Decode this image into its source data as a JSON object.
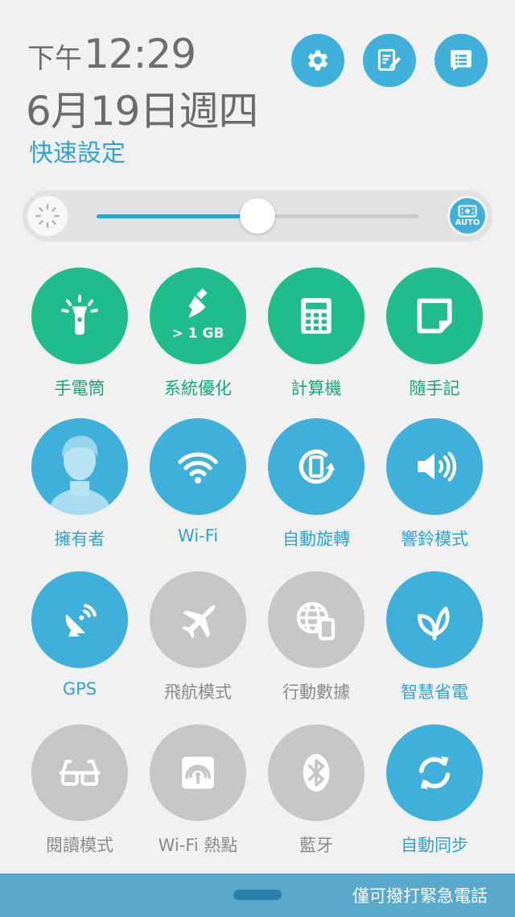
{
  "header": {
    "ampm": "下午",
    "time": "12:29",
    "date": "6月19日週四",
    "section_title": "快速設定",
    "buttons": [
      {
        "name": "settings",
        "icon": "gear-icon"
      },
      {
        "name": "edit",
        "icon": "edit-note-icon"
      },
      {
        "name": "notifications",
        "icon": "list-bubble-icon"
      }
    ]
  },
  "brightness": {
    "level_percent": 50,
    "auto_label": "AUTO"
  },
  "tiles": [
    {
      "label": "手電筒",
      "icon": "flashlight-icon",
      "state": "green"
    },
    {
      "label": "系統優化",
      "icon": "broom-icon",
      "state": "green",
      "sublabel": "> 1 GB"
    },
    {
      "label": "計算機",
      "icon": "calculator-icon",
      "state": "green"
    },
    {
      "label": "隨手記",
      "icon": "note-icon",
      "state": "green"
    },
    {
      "label": "擁有者",
      "icon": "avatar-icon",
      "state": "blue"
    },
    {
      "label": "Wi-Fi",
      "icon": "wifi-icon",
      "state": "blue"
    },
    {
      "label": "自動旋轉",
      "icon": "auto-rotate-icon",
      "state": "blue"
    },
    {
      "label": "響鈴模式",
      "icon": "speaker-icon",
      "state": "blue"
    },
    {
      "label": "GPS",
      "icon": "gps-dish-icon",
      "state": "blue"
    },
    {
      "label": "飛航模式",
      "icon": "airplane-icon",
      "state": "gray"
    },
    {
      "label": "行動數據",
      "icon": "mobile-data-icon",
      "state": "gray"
    },
    {
      "label": "智慧省電",
      "icon": "leaf-icon",
      "state": "blue"
    },
    {
      "label": "閱讀模式",
      "icon": "glasses-icon",
      "state": "gray"
    },
    {
      "label": "Wi-Fi 熱點",
      "icon": "hotspot-icon",
      "state": "gray"
    },
    {
      "label": "藍牙",
      "icon": "bluetooth-icon",
      "state": "gray"
    },
    {
      "label": "自動同步",
      "icon": "sync-icon",
      "state": "blue"
    }
  ],
  "bottom": {
    "emergency_text": "僅可撥打緊急電話"
  },
  "colors": {
    "green": "#1ebd8b",
    "blue": "#3fb0da",
    "gray": "#c6c6c6",
    "accent_text": "#2ea3d4"
  }
}
